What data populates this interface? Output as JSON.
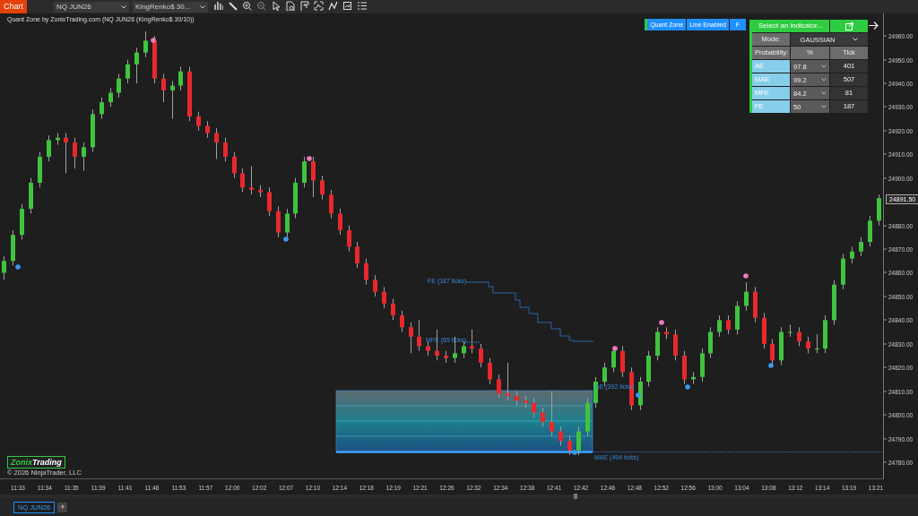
{
  "toolbar": {
    "chart_button": "Chart",
    "instrument": "NQ JUN26",
    "bar_type": "KingRenko$ 30..."
  },
  "chart": {
    "title": "Quant Zone by ZonixTrading.com (NQ JUN26 (KingRenko$ 30/10))",
    "toggles": [
      {
        "label": "Quant Zone"
      },
      {
        "label": "Line Enabled"
      },
      {
        "label": "F"
      }
    ],
    "panel": {
      "header": "Select an indicator...",
      "mode_label": "Mode:",
      "mode": "GAUSSIAN",
      "columns": [
        "Probability:",
        "%",
        "Tick"
      ],
      "rows": [
        {
          "name": "AE",
          "percent": "97.8",
          "tick": "401"
        },
        {
          "name": "MAE",
          "percent": "99.2",
          "tick": "507"
        },
        {
          "name": "MFE",
          "percent": "84.2",
          "tick": "81"
        },
        {
          "name": "FE",
          "percent": "50",
          "tick": "187"
        }
      ]
    },
    "annotations": [
      {
        "kind": "fe",
        "label": "FE (187 ticks)"
      },
      {
        "kind": "mfe",
        "label": "MFE (85 ticks)"
      },
      {
        "kind": "ae",
        "label": "AE (392 ticks)"
      },
      {
        "kind": "mae",
        "label": "MAE (494 ticks)"
      }
    ],
    "chart_data": {
      "type": "candlestick",
      "ylim": [
        24772.8,
        24969.5
      ],
      "categories": [
        null,
        null,
        null,
        null,
        null,
        null,
        null,
        null,
        null,
        null,
        null,
        null,
        null,
        null,
        null,
        null,
        null,
        null,
        null,
        null,
        null,
        null,
        null,
        null,
        null,
        null,
        null,
        null,
        null,
        null,
        null,
        null,
        null,
        null,
        null,
        null,
        null,
        null,
        null,
        null,
        null,
        null,
        null,
        null,
        null,
        null,
        null,
        null,
        null,
        null,
        null,
        null,
        null,
        null,
        null,
        null,
        null,
        null,
        null,
        null,
        null,
        null,
        null,
        null,
        null,
        null,
        null,
        null,
        null,
        null,
        null,
        null,
        null,
        null,
        null,
        null,
        null,
        null,
        null,
        null,
        null,
        null,
        null,
        null,
        null,
        null,
        null,
        null,
        null,
        null,
        null,
        null,
        null,
        null,
        null,
        null,
        null,
        null,
        null,
        null
      ],
      "ohlc": [
        [
          24860,
          24867,
          24857,
          24865
        ],
        [
          24865,
          24878,
          24863,
          24876
        ],
        [
          24876,
          24889,
          24874,
          24887
        ],
        [
          24887,
          24900,
          24885,
          24898
        ],
        [
          24898,
          24911,
          24896,
          24909
        ],
        [
          24909,
          24918,
          24907,
          24916
        ],
        [
          24916,
          24919,
          24914,
          24917
        ],
        [
          24917,
          24919,
          24902,
          24915
        ],
        [
          24915,
          24917,
          24904,
          24909
        ],
        [
          24909,
          24915,
          24903,
          24913
        ],
        [
          24913,
          24929,
          24911,
          24927
        ],
        [
          24927,
          24934,
          24925,
          24932
        ],
        [
          24932,
          24938,
          24930,
          24936
        ],
        [
          24936,
          24944,
          24934,
          24942
        ],
        [
          24942,
          24950,
          24940,
          24948
        ],
        [
          24948,
          24955,
          24940,
          24953
        ],
        [
          24953,
          24962,
          24951,
          24958
        ],
        [
          24958,
          24960,
          24940,
          24942
        ],
        [
          24942,
          24944,
          24932,
          24937
        ],
        [
          24937,
          24941,
          24925,
          24939
        ],
        [
          24939,
          24947,
          24937,
          24945
        ],
        [
          24945,
          24947,
          24924,
          24926
        ],
        [
          24926,
          24928,
          24920,
          24922
        ],
        [
          24922,
          24924,
          24917,
          24919
        ],
        [
          24919,
          24921,
          24908,
          24915
        ],
        [
          24915,
          24917,
          24907,
          24909
        ],
        [
          24909,
          24911,
          24900,
          24902
        ],
        [
          24902,
          24904,
          24894,
          24896
        ],
        [
          24896,
          24905,
          24893,
          24895
        ],
        [
          24895,
          24897,
          24892,
          24894
        ],
        [
          24894,
          24896,
          24884,
          24886
        ],
        [
          24886,
          24888,
          24875,
          24877
        ],
        [
          24877,
          24887,
          24875,
          24885
        ],
        [
          24885,
          24900,
          24883,
          24898
        ],
        [
          24898,
          24909,
          24896,
          24907
        ],
        [
          24907,
          24909,
          24892,
          24899
        ],
        [
          24899,
          24901,
          24891,
          24893
        ],
        [
          24893,
          24895,
          24883,
          24885
        ],
        [
          24885,
          24887,
          24876,
          24878
        ],
        [
          24878,
          24880,
          24869,
          24871
        ],
        [
          24871,
          24873,
          24862,
          24864
        ],
        [
          24864,
          24866,
          24855,
          24857
        ],
        [
          24857,
          24859,
          24850,
          24852
        ],
        [
          24852,
          24854,
          24845,
          24847
        ],
        [
          24847,
          24849,
          24840,
          24842
        ],
        [
          24842,
          24844,
          24835,
          24837
        ],
        [
          24837,
          24839,
          24826,
          24833
        ],
        [
          24833,
          24840,
          24827,
          24829
        ],
        [
          24829,
          24831,
          24825,
          24827
        ],
        [
          24827,
          24836,
          24823,
          24825
        ],
        [
          24825,
          24827,
          24822,
          24824
        ],
        [
          24824,
          24833,
          24822,
          24826
        ],
        [
          24826,
          24831,
          24824,
          24829
        ],
        [
          24829,
          24836,
          24826,
          24828
        ],
        [
          24828,
          24830,
          24820,
          24822
        ],
        [
          24822,
          24824,
          24813,
          24815
        ],
        [
          24815,
          24817,
          24807,
          24809
        ],
        [
          24809,
          24822,
          24806,
          24808
        ],
        [
          24808,
          24810,
          24804,
          24806
        ],
        [
          24806,
          24808,
          24803,
          24805
        ],
        [
          24805,
          24807,
          24799,
          24801
        ],
        [
          24801,
          24803,
          24795,
          24797
        ],
        [
          24797,
          24810,
          24791,
          24793
        ],
        [
          24793,
          24795,
          24787,
          24789
        ],
        [
          24789,
          24791,
          24783,
          24785
        ],
        [
          24785,
          24795,
          24783,
          24793
        ],
        [
          24793,
          24807,
          24791,
          24805
        ],
        [
          24805,
          24816,
          24803,
          24814
        ],
        [
          24814,
          24822,
          24812,
          24820
        ],
        [
          24820,
          24829,
          24818,
          24827
        ],
        [
          24827,
          24829,
          24816,
          24818
        ],
        [
          24818,
          24820,
          24802,
          24804
        ],
        [
          24804,
          24816,
          24802,
          24814
        ],
        [
          24814,
          24827,
          24812,
          24825
        ],
        [
          24825,
          24837,
          24823,
          24835
        ],
        [
          24835,
          24837,
          24832,
          24834
        ],
        [
          24834,
          24836,
          24823,
          24825
        ],
        [
          24825,
          24827,
          24813,
          24815
        ],
        [
          24815,
          24818,
          24813,
          24816
        ],
        [
          24816,
          24828,
          24814,
          24826
        ],
        [
          24826,
          24837,
          24824,
          24835
        ],
        [
          24835,
          24842,
          24833,
          24840
        ],
        [
          24840,
          24842,
          24834,
          24836
        ],
        [
          24836,
          24848,
          24834,
          24846
        ],
        [
          24846,
          24856,
          24844,
          24852
        ],
        [
          24852,
          24854,
          24839,
          24841
        ],
        [
          24841,
          24843,
          24828,
          24830
        ],
        [
          24830,
          24832,
          24821,
          24823
        ],
        [
          24823,
          24837,
          24821,
          24835
        ],
        [
          24835,
          24838,
          24833,
          24835
        ],
        [
          24835,
          24837,
          24829,
          24831
        ],
        [
          24831,
          24833,
          24826,
          24828
        ],
        [
          24828,
          24834,
          24826,
          24828
        ],
        [
          24828,
          24842,
          24826,
          24840
        ],
        [
          24840,
          24857,
          24838,
          24855
        ],
        [
          24855,
          24868,
          24853,
          24866
        ],
        [
          24866,
          24871,
          24864,
          24869
        ],
        [
          24869,
          24875,
          24867,
          24873
        ],
        [
          24873,
          24884,
          24871,
          24882
        ],
        [
          24882,
          24893,
          24880,
          24891.5
        ]
      ],
      "yticks": [
        {
          "value": 24960,
          "label": "24960.00"
        },
        {
          "value": 24950,
          "label": "24950.00"
        },
        {
          "value": 24940,
          "label": "24940.00"
        },
        {
          "value": 24930,
          "label": "24930.00"
        },
        {
          "value": 24920,
          "label": "24920.00"
        },
        {
          "value": 24910,
          "label": "24910.00"
        },
        {
          "value": 24900,
          "label": "24900.00"
        },
        {
          "value": 24880,
          "label": "24880.00"
        },
        {
          "value": 24870,
          "label": "24870.00"
        },
        {
          "value": 24860,
          "label": "24860.00"
        },
        {
          "value": 24850,
          "label": "24850.00"
        },
        {
          "value": 24840,
          "label": "24840.00"
        },
        {
          "value": 24830,
          "label": "24830.00"
        },
        {
          "value": 24820,
          "label": "24820.00"
        },
        {
          "value": 24810,
          "label": "24810.00"
        },
        {
          "value": 24800,
          "label": "24800.00"
        },
        {
          "value": 24790,
          "label": "24790.00"
        },
        {
          "value": 24780,
          "label": "24780.00"
        }
      ]
    },
    "time_labels": [
      "11:33",
      "11:34",
      "11:35",
      "11:39",
      "11:41",
      "11:46",
      "11:53",
      "11:57",
      "12:00",
      "12:02",
      "12:07",
      "12:10",
      "12:14",
      "12:18",
      "12:19",
      "12:21",
      "12:26",
      "12:32",
      "12:34",
      "12:38",
      "12:41",
      "12:42",
      "12:46",
      "12:48",
      "12:52",
      "12:56",
      "13:00",
      "13:04",
      "13:08",
      "13:12",
      "13:14",
      "13:19",
      "13:21"
    ],
    "last_price": "24891.50",
    "logo": {
      "first": "Zonix",
      "second": "Trading"
    },
    "copyright": "© 2026 NinjaTrader, LLC"
  },
  "tabs": [
    {
      "label": "NQ JUN26",
      "selected": true
    }
  ],
  "add_tab": "+"
}
